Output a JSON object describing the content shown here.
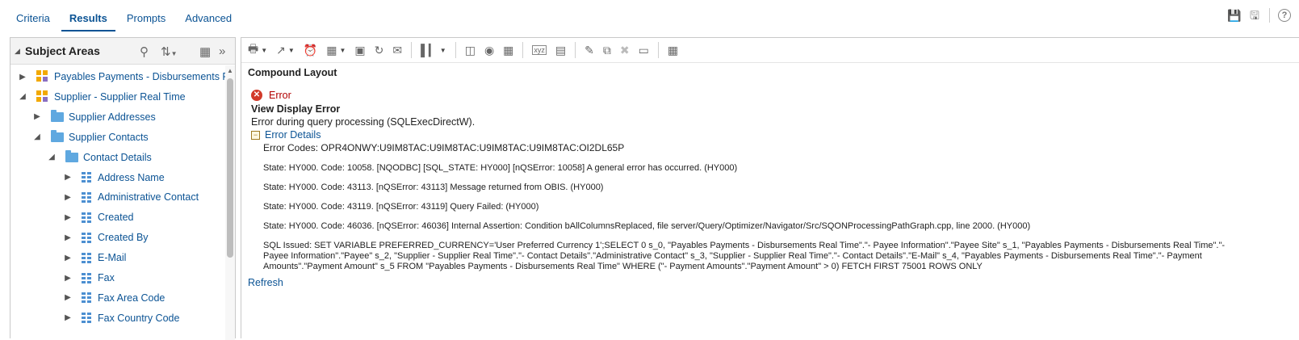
{
  "tabs": [
    "Criteria",
    "Results",
    "Prompts",
    "Advanced"
  ],
  "subject_areas": {
    "title": "Subject Areas",
    "tree": [
      {
        "label": "Payables Payments - Disbursements Real Time",
        "type": "subject-area",
        "level": 0,
        "expanded": false
      },
      {
        "label": "Supplier - Supplier Real Time",
        "type": "subject-area",
        "level": 0,
        "expanded": true
      },
      {
        "label": "Supplier Addresses",
        "type": "folder",
        "level": 1,
        "expanded": false
      },
      {
        "label": "Supplier Contacts",
        "type": "folder",
        "level": 1,
        "expanded": true
      },
      {
        "label": "Contact Details",
        "type": "folder",
        "level": 2,
        "expanded": true
      },
      {
        "label": "Address Name",
        "type": "column",
        "level": 3,
        "expanded": false
      },
      {
        "label": "Administrative Contact",
        "type": "column",
        "level": 3,
        "expanded": false
      },
      {
        "label": "Created",
        "type": "column",
        "level": 3,
        "expanded": false
      },
      {
        "label": "Created By",
        "type": "column",
        "level": 3,
        "expanded": false
      },
      {
        "label": "E-Mail",
        "type": "column",
        "level": 3,
        "expanded": false
      },
      {
        "label": "Fax",
        "type": "column",
        "level": 3,
        "expanded": false
      },
      {
        "label": "Fax Area Code",
        "type": "column",
        "level": 3,
        "expanded": false
      },
      {
        "label": "Fax Country Code",
        "type": "column",
        "level": 3,
        "expanded": false
      }
    ]
  },
  "results": {
    "layout_title": "Compound Layout",
    "error": {
      "word": "Error",
      "view_title": "View Display Error",
      "message": "Error during query processing (SQLExecDirectW).",
      "details_label": "Error Details",
      "codes_label": "Error Codes: ",
      "codes_value": "OPR4ONWY:U9IM8TAC:U9IM8TAC:U9IM8TAC:U9IM8TAC:OI2DL65P",
      "states": [
        "State: HY000. Code: 10058. [NQODBC] [SQL_STATE: HY000] [nQSError: 10058] A general error has occurred. (HY000)",
        "State: HY000. Code: 43113. [nQSError: 43113] Message returned from OBIS. (HY000)",
        "State: HY000. Code: 43119. [nQSError: 43119] Query Failed: (HY000)",
        "State: HY000. Code: 46036. [nQSError: 46036] Internal Assertion: Condition bAllColumnsReplaced, file server/Query/Optimizer/Navigator/Src/SQONProcessingPathGraph.cpp, line 2000. (HY000)"
      ],
      "sql": "SQL Issued: SET VARIABLE PREFERRED_CURRENCY='User Preferred Currency 1';SELECT 0 s_0, \"Payables Payments - Disbursements Real Time\".\"- Payee Information\".\"Payee Site\" s_1, \"Payables Payments - Disbursements Real Time\".\"- Payee Information\".\"Payee\" s_2, \"Supplier - Supplier Real Time\".\"- Contact Details\".\"Administrative Contact\" s_3, \"Supplier - Supplier Real Time\".\"- Contact Details\".\"E-Mail\" s_4, \"Payables Payments - Disbursements Real Time\".\"- Payment Amounts\".\"Payment Amount\" s_5 FROM \"Payables Payments - Disbursements Real Time\" WHERE (\"- Payment Amounts\".\"Payment Amount\" > 0) FETCH FIRST 75001 ROWS ONLY"
    },
    "refresh_label": "Refresh"
  }
}
